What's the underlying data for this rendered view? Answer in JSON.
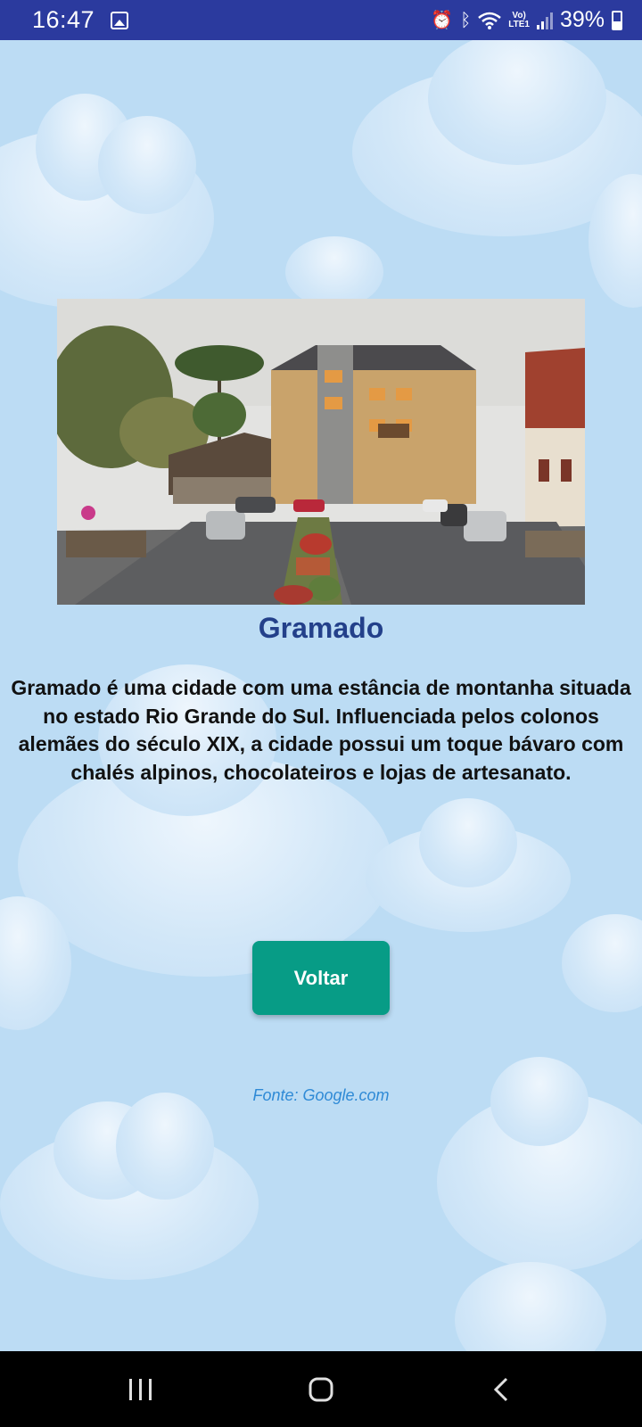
{
  "status_bar": {
    "time": "16:47",
    "lte_line1": "Vo)",
    "lte_line2": "LTE1",
    "battery": "39%"
  },
  "main": {
    "image_alt": "Gramado",
    "title": "Gramado",
    "description": "Gramado é uma cidade com uma estância de montanha situada no estado Rio Grande do Sul. Influenciada pelos colonos alemães do século XIX, a cidade possui um toque bávaro com chalés alpinos, chocolateiros e lojas de artesanato.",
    "back_button": "Voltar",
    "source": "Fonte: Google.com"
  },
  "colors": {
    "status_bar": "#2b3a9e",
    "sky": "#bcdcf4",
    "title": "#23408a",
    "button": "#079c86",
    "source": "#2f8ad6"
  }
}
